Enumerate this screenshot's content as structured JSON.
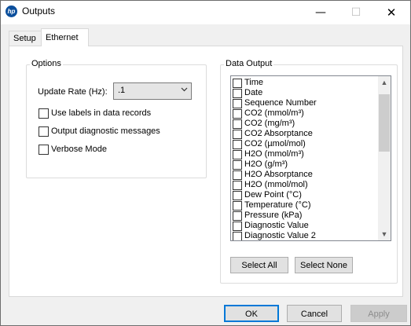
{
  "window": {
    "title": "Outputs",
    "app_icon_text": "hp"
  },
  "caption_buttons": {
    "minimize": "—",
    "maximize": "☐",
    "close": "✕"
  },
  "tabs": [
    {
      "label": "Setup",
      "active": false
    },
    {
      "label": "Ethernet",
      "active": true
    }
  ],
  "options": {
    "legend": "Options",
    "update_rate_label": "Update Rate (Hz):",
    "update_rate_value": ".1",
    "checkboxes": [
      {
        "label": "Use labels in data records",
        "checked": false
      },
      {
        "label": "Output diagnostic messages",
        "checked": false
      },
      {
        "label": "Verbose Mode",
        "checked": false
      }
    ]
  },
  "data_output": {
    "legend": "Data Output",
    "items": [
      {
        "label": "Time",
        "checked": false
      },
      {
        "label": "Date",
        "checked": false
      },
      {
        "label": "Sequence Number",
        "checked": false
      },
      {
        "label": "CO2 (mmol/m³)",
        "checked": false
      },
      {
        "label": "CO2 (mg/m³)",
        "checked": false
      },
      {
        "label": "CO2 Absorptance",
        "checked": false
      },
      {
        "label": "CO2 (µmol/mol)",
        "checked": false
      },
      {
        "label": "H2O (mmol/m³)",
        "checked": false
      },
      {
        "label": "H2O (g/m³)",
        "checked": false
      },
      {
        "label": "H2O Absorptance",
        "checked": false
      },
      {
        "label": "H2O (mmol/mol)",
        "checked": false
      },
      {
        "label": "Dew Point (°C)",
        "checked": false
      },
      {
        "label": "Temperature (°C)",
        "checked": false
      },
      {
        "label": "Pressure (kPa)",
        "checked": false
      },
      {
        "label": "Diagnostic Value",
        "checked": false
      },
      {
        "label": "Diagnostic Value 2",
        "checked": false
      }
    ],
    "select_all_label": "Select All",
    "select_none_label": "Select None"
  },
  "footer": {
    "ok_label": "OK",
    "cancel_label": "Cancel",
    "apply_label": "Apply"
  },
  "colors": {
    "focus_border": "#0078d7",
    "app_icon": "#0b4f9c",
    "disabled_text": "#8c8c8c"
  }
}
